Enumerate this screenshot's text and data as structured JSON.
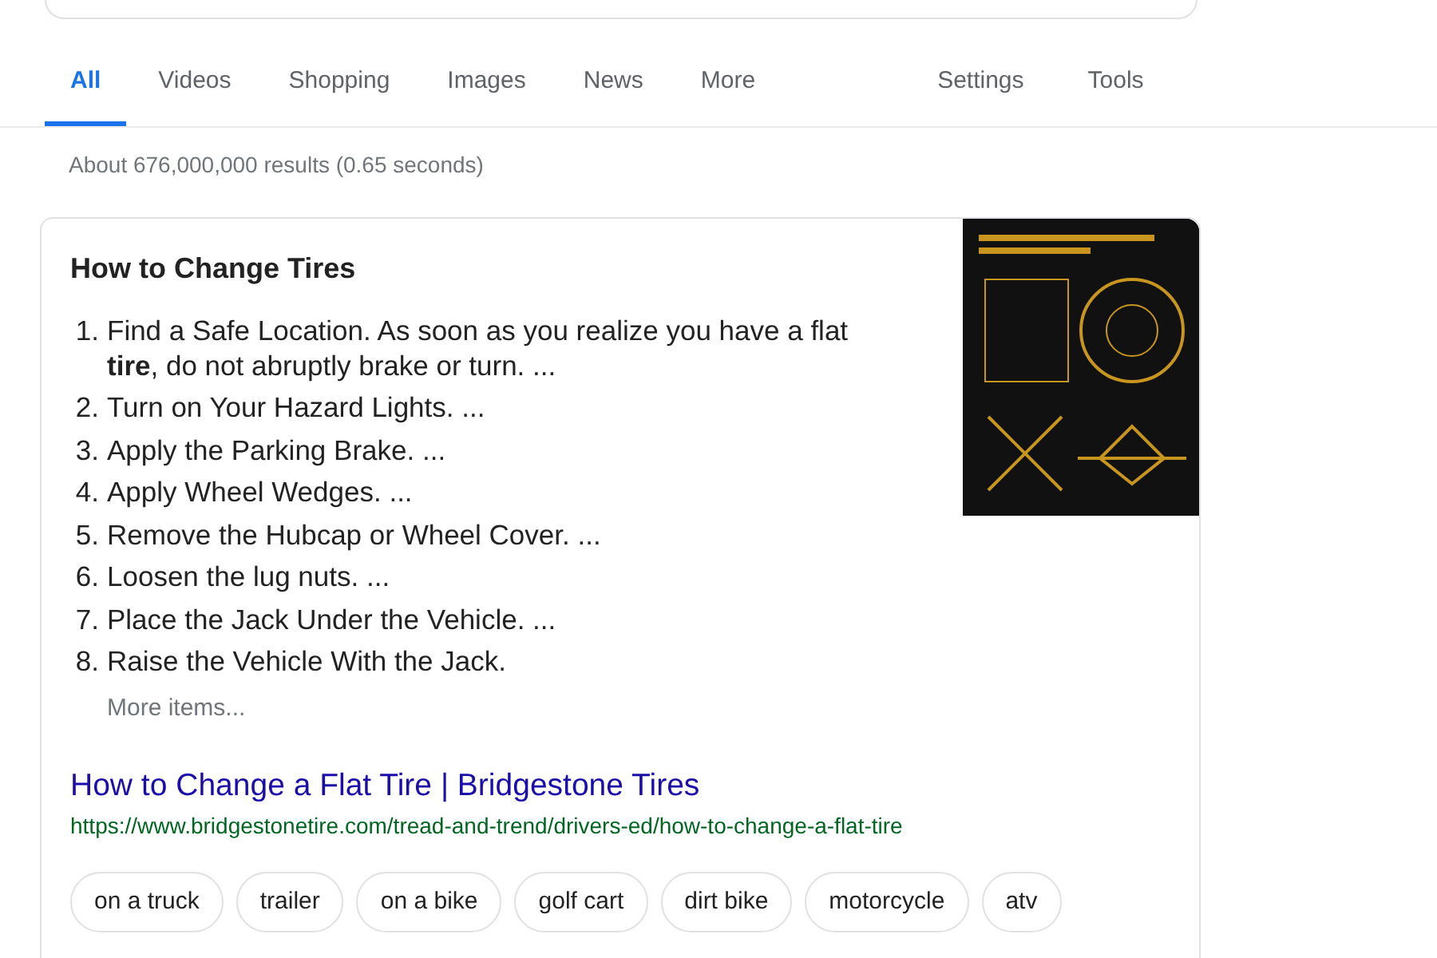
{
  "tabs": [
    {
      "label": "All",
      "selected": true
    },
    {
      "label": "Videos",
      "selected": false
    },
    {
      "label": "Shopping",
      "selected": false
    },
    {
      "label": "Images",
      "selected": false
    },
    {
      "label": "News",
      "selected": false
    },
    {
      "label": "More",
      "selected": false
    }
  ],
  "tools": [
    "Settings",
    "Tools"
  ],
  "result_stats": "About 676,000,000 results (0.65 seconds)",
  "featured_snippet": {
    "title": "How to Change Tires",
    "steps": [
      {
        "number": "1.",
        "text": "Find a Safe Location. As soon as you realize you have a flat **tire**, do not abruptly brake or turn. ..."
      },
      {
        "number": "2.",
        "text": "Turn on Your Hazard Lights. ..."
      },
      {
        "number": "3.",
        "text": "Apply the Parking Brake. ..."
      },
      {
        "number": "4.",
        "text": "Apply Wheel Wedges. ..."
      },
      {
        "number": "5.",
        "text": "Remove the Hubcap or Wheel Cover. ..."
      },
      {
        "number": "6.",
        "text": "Loosen the lug nuts. ..."
      },
      {
        "number": "7.",
        "text": "Place the Jack Under the Vehicle. ..."
      },
      {
        "number": "8.",
        "text": "Raise the Vehicle With the Jack."
      }
    ],
    "more_items": "More items...",
    "link_title": "How to Change a Flat Tire | Bridgestone Tires",
    "url": "https://www.bridgestonetire.com/tread-and-trend/drivers-ed/how-to-change-a-flat-tire"
  },
  "related_chips": [
    "on a truck",
    "trailer",
    "on a bike",
    "golf cart",
    "dirt bike",
    "motorcycle",
    "atv"
  ]
}
